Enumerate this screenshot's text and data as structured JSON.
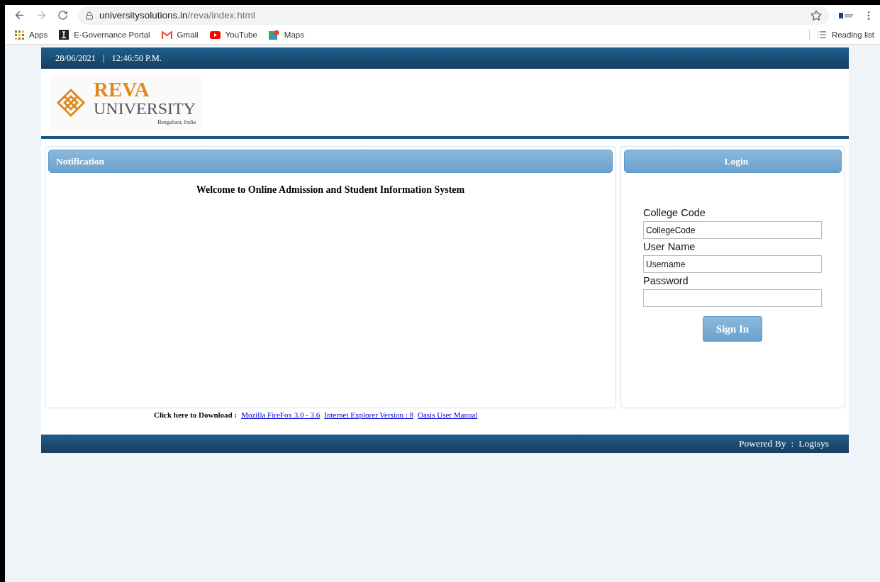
{
  "browser": {
    "url_host": "universitysolutions.in",
    "url_path": "/reva/index.html",
    "bookmarks": [
      {
        "label": "Apps",
        "kind": "apps"
      },
      {
        "label": "E-Governance Portal",
        "kind": "portal"
      },
      {
        "label": "Gmail",
        "kind": "gmail"
      },
      {
        "label": "YouTube",
        "kind": "youtube"
      },
      {
        "label": "Maps",
        "kind": "maps"
      }
    ],
    "reading_list": "Reading list"
  },
  "header": {
    "date": "28/06/2021",
    "separator": "|",
    "time": "12:46:50 P.M."
  },
  "logo": {
    "name": "REVA",
    "subtitle": "UNIVERSITY",
    "place": "Bengaluru, India"
  },
  "notification": {
    "title": "Notification",
    "message": "Welcome to Online Admission and Student Information System"
  },
  "login": {
    "title": "Login",
    "fields": [
      {
        "label": "College Code",
        "value": "CollegeCode",
        "kind": "text"
      },
      {
        "label": "User Name",
        "value": "Username",
        "kind": "text"
      },
      {
        "label": "Password",
        "kind": "password"
      }
    ],
    "button": "Sign In"
  },
  "downloads": {
    "label": "Click here to Download :",
    "links": [
      "Mozilla FireFox 3.0 - 3.6",
      "Internet Explorer Version : 8",
      "Oasis User Manual"
    ]
  },
  "footer": {
    "label": "Powered By",
    "separator": ":",
    "company": "Logisys"
  }
}
